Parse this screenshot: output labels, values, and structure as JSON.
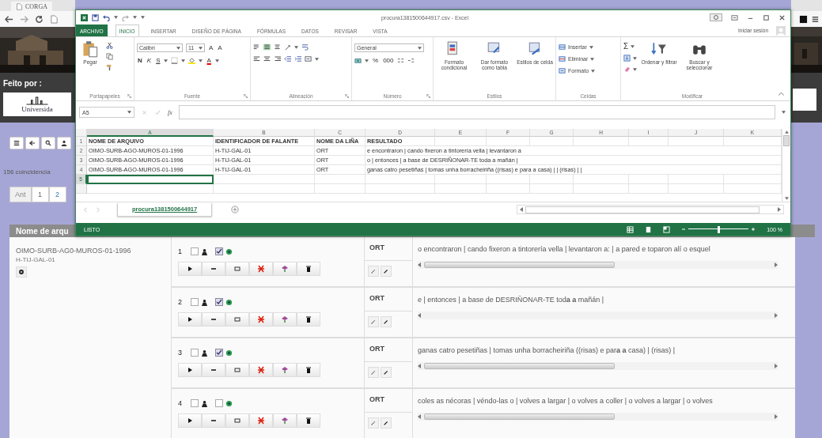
{
  "browser": {
    "tab_title": "CORGA"
  },
  "sidebar": {
    "credit_label": "Feito por :",
    "logo_text": "Universida",
    "match_count": "156 coincidencia",
    "pages": [
      {
        "label": "Ant",
        "disabled": true,
        "selected": false
      },
      {
        "label": "1",
        "disabled": false,
        "selected": true
      },
      {
        "label": "2",
        "disabled": false,
        "selected": false
      }
    ]
  },
  "results": {
    "header": "Nome de arqu",
    "file": {
      "name": "OIMO-SURB-AG0-MUROS-01-1996",
      "speaker": "H-TIJ-GAL-01"
    },
    "lines": [
      {
        "number": "1",
        "flag_checked": false,
        "audio_checked": true,
        "tier": "ORT",
        "text": "o encontraron | cando fixeron a tintorería vella | levantaron a: | a pared e toparon alí o esquel"
      },
      {
        "number": "2",
        "flag_checked": false,
        "audio_checked": true,
        "tier": "ORT",
        "text": "e | entonces | a base de DESRIÑONAR-TE tod**a a** mañán |"
      },
      {
        "number": "3",
        "flag_checked": false,
        "audio_checked": true,
        "tier": "ORT",
        "text": "ganas catro pesetiñas | tomas unha borracheiriña ((risas) e par**a a** casa) | (risas) |"
      },
      {
        "number": "4",
        "flag_checked": false,
        "audio_checked": false,
        "tier": "ORT",
        "text": "coles as nécoras | véndo-las o | volves a largar | o volves a coller | o volves a largar | o volves"
      }
    ]
  },
  "excel": {
    "title": "procura1381500644917.csv - Excel",
    "ribbon_tabs": [
      {
        "label": "ARCHIVO",
        "kind": "backstage",
        "selected": false
      },
      {
        "label": "INICIO",
        "kind": "tab",
        "selected": true
      },
      {
        "label": "INSERTAR",
        "kind": "tab",
        "selected": false
      },
      {
        "label": "DISEÑO DE PÁGINA",
        "kind": "tab",
        "selected": false
      },
      {
        "label": "FÓRMULAS",
        "kind": "tab",
        "selected": false
      },
      {
        "label": "DATOS",
        "kind": "tab",
        "selected": false
      },
      {
        "label": "REVISAR",
        "kind": "tab",
        "selected": false
      },
      {
        "label": "VISTA",
        "kind": "tab",
        "selected": false
      }
    ],
    "sign_in": "Iniciar sesión",
    "clipboard": {
      "label": "Portapapeles",
      "paste": "Pegar"
    },
    "font": {
      "label": "Fuente",
      "name": "Calibri",
      "size": "11",
      "grow": "A",
      "shrink": "A",
      "bold": "N",
      "italic": "K",
      "underline": "S",
      "color_letter": "A"
    },
    "alignment": {
      "label": "Alineación"
    },
    "number": {
      "label": "Número",
      "format": "General",
      "percent": "%",
      "thousands": "000"
    },
    "styles": {
      "label": "Estilos",
      "buttons": [
        "Formato condicional",
        "Dar formato como tabla",
        "Estilos de celda"
      ]
    },
    "cells": {
      "label": "Celdas",
      "buttons": [
        "Insertar",
        "Eliminar",
        "Formato"
      ]
    },
    "editing": {
      "label": "Modificar",
      "autosum": "Σ",
      "buttons": [
        "Ordenar y filtrar",
        "Buscar y seleccionar"
      ]
    },
    "name_box": "A5",
    "function_symbol": "fx",
    "columns": [
      "A",
      "B",
      "C",
      "D",
      "E",
      "F",
      "G",
      "H",
      "I",
      "J",
      "K"
    ],
    "rows": [
      {
        "number": "1",
        "selected": false,
        "cells": [
          "NOME DE ARQUIVO",
          "IDENTIFICADOR DE FALANTE",
          "NOME DA LIÑA",
          "RESULTADO"
        ]
      },
      {
        "number": "2",
        "selected": false,
        "cells": [
          "OIMO-SURB-AGO-MUROS-01-1996",
          "H-TIJ-GAL-01",
          "ORT",
          "e encontraron | cando fixeron a tintorería vella | levantaron a"
        ]
      },
      {
        "number": "3",
        "selected": false,
        "cells": [
          "OIMO-SURB-AGO-MUROS-01-1996",
          "H-TIJ-GAL-01",
          "ORT",
          "o | entonces | a base de DESRIÑONAR-TE toda a mañán |"
        ]
      },
      {
        "number": "4",
        "selected": false,
        "cells": [
          "OIMO-SURB-AGO-MUROS-01-1996",
          "H-TIJ-GAL-01",
          "ORT",
          "ganas catro pesetiñas | tomas unha borracheiriña ((risas) e para a casa) | | (risas) | |"
        ]
      },
      {
        "number": "5",
        "selected": true,
        "cells": []
      }
    ],
    "sheet_tabs": [
      {
        "label": "procura1381500644917",
        "selected": true
      }
    ],
    "status": "LISTO",
    "zoom": {
      "level": 0.5,
      "reading": "100 %"
    }
  }
}
